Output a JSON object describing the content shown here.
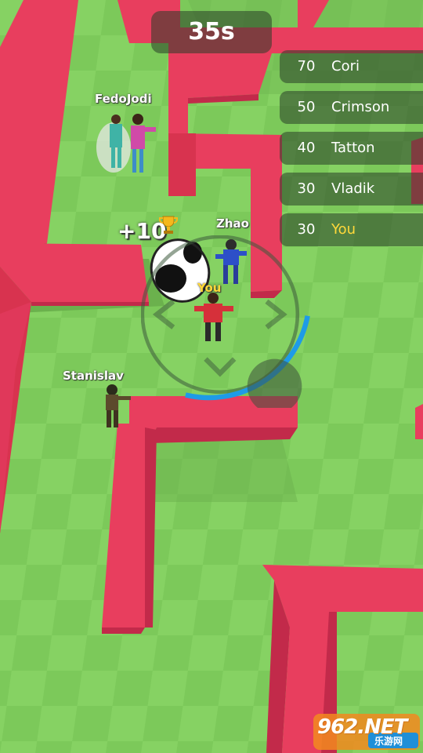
{
  "hud": {
    "timer": "35s",
    "score_popup": "+10"
  },
  "leaderboard": [
    {
      "score": "70",
      "name": "Cori"
    },
    {
      "score": "50",
      "name": "Crimson"
    },
    {
      "score": "40",
      "name": "Tatton"
    },
    {
      "score": "30",
      "name": "Vladik"
    },
    {
      "score": "30",
      "name": "You"
    }
  ],
  "players": {
    "fedojodi": "FedoJodi",
    "zhao": "Zhao",
    "you": "You",
    "stanislav": "Stanislav"
  },
  "watermark": {
    "logo_text": "962.NET",
    "sub_text": "乐游网"
  },
  "colors": {
    "ground": "#7cc95a",
    "wall_top": "#e83e5e",
    "wall_side": "#c22a4a",
    "timer_bg": "rgba(40,60,40,0.55)",
    "highlight": "#ffd83a",
    "progress_arc": "#1e9be8"
  },
  "icons": [
    "trophy-icon",
    "joystick-left-arrow-icon",
    "joystick-right-arrow-icon",
    "joystick-down-arrow-icon"
  ]
}
